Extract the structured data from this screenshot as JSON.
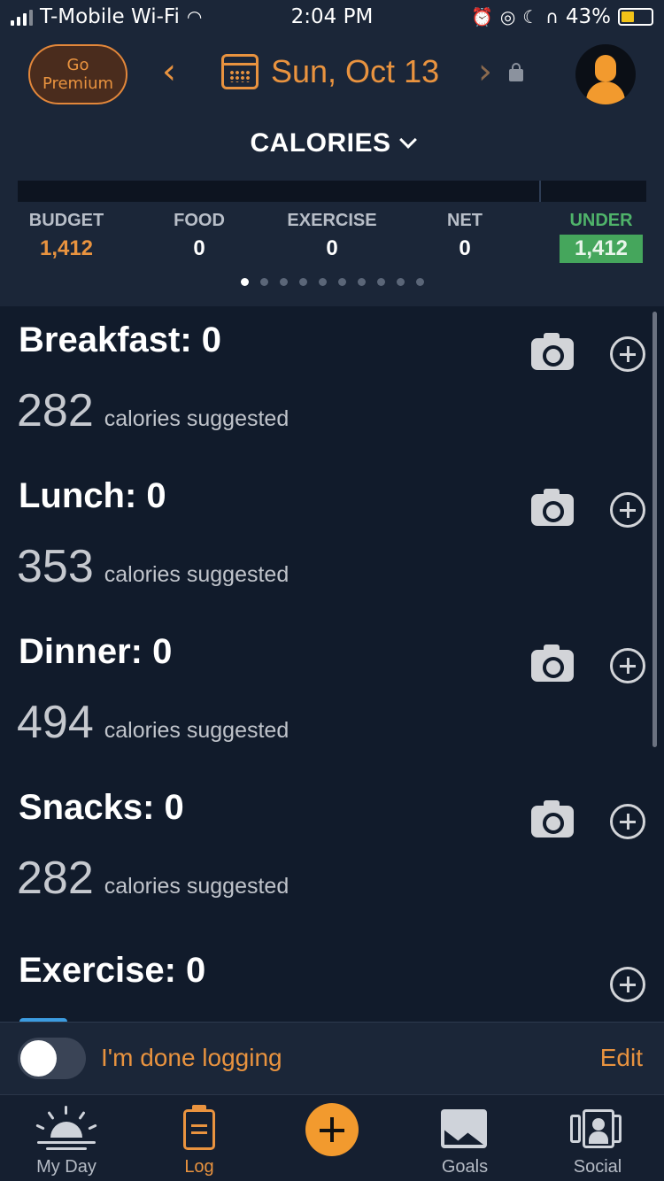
{
  "status_bar": {
    "carrier": "T-Mobile Wi-Fi",
    "time": "2:04 PM",
    "battery": "43%",
    "battery_level": 0.43
  },
  "header": {
    "premium_line1": "Go",
    "premium_line2": "Premium",
    "prev_arrow": "‹",
    "next_arrow": "›",
    "date": "Sun, Oct 13",
    "section_title": "CALORIES"
  },
  "summary": {
    "budget_label": "BUDGET",
    "budget_value": "1,412",
    "food_label": "FOOD",
    "food_value": "0",
    "exercise_label": "EXERCISE",
    "exercise_value": "0",
    "net_label": "NET",
    "net_value": "0",
    "under_label": "UNDER",
    "under_value": "1,412",
    "page_count": 10,
    "active_page": 1
  },
  "meals": [
    {
      "title": "Breakfast: 0",
      "suggested": "282",
      "suggested_text": "calories suggested"
    },
    {
      "title": "Lunch: 0",
      "suggested": "353",
      "suggested_text": "calories suggested"
    },
    {
      "title": "Dinner: 0",
      "suggested": "494",
      "suggested_text": "calories suggested"
    },
    {
      "title": "Snacks: 0",
      "suggested": "282",
      "suggested_text": "calories suggested"
    }
  ],
  "exercise": {
    "title": "Exercise: 0"
  },
  "done_bar": {
    "label": "I'm done logging",
    "edit": "Edit",
    "toggle_on": false
  },
  "tabs": [
    {
      "label": "My Day",
      "icon": "sunrise-icon"
    },
    {
      "label": "Log",
      "icon": "clipboard-icon",
      "active": true
    },
    {
      "label": "",
      "icon": "add-icon"
    },
    {
      "label": "Goals",
      "icon": "chart-icon"
    },
    {
      "label": "Social",
      "icon": "people-icon"
    }
  ],
  "colors": {
    "accent": "#e9933f",
    "background": "#111b2b",
    "header_bg": "#1b2638",
    "under_green": "#45a65c"
  }
}
